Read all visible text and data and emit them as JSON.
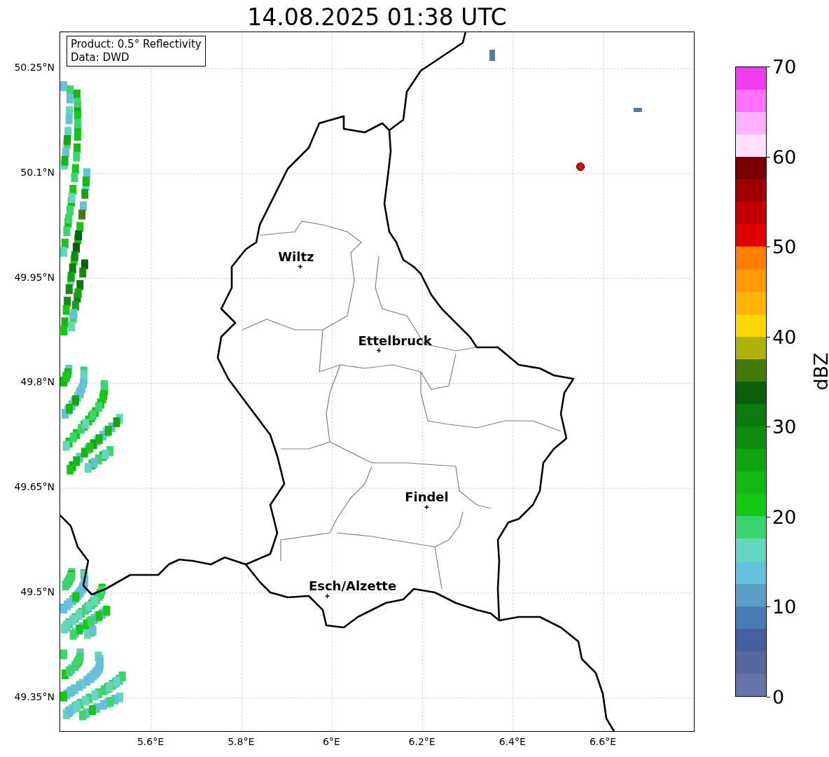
{
  "title": "14.08.2025 01:38 UTC",
  "info_box": {
    "lines": [
      "Product: 0.5° Reflectivity",
      "Data: DWD"
    ]
  },
  "y_ticks": [
    "50.25°N",
    "50.1°N",
    "49.95°N",
    "49.8°N",
    "49.65°N",
    "49.5°N",
    "49.35°N"
  ],
  "x_ticks": [
    "5.6°E",
    "5.8°E",
    "6°E",
    "6.2°E",
    "6.4°E",
    "6.6°E"
  ],
  "cities": [
    {
      "name": "Wiltz"
    },
    {
      "name": "Ettelbruck"
    },
    {
      "name": "Findel"
    },
    {
      "name": "Esch/Alzette"
    }
  ],
  "colorbar": {
    "label": "dBZ",
    "ticks": [
      "70",
      "60",
      "50",
      "40",
      "30",
      "20",
      "10",
      "0"
    ]
  }
}
